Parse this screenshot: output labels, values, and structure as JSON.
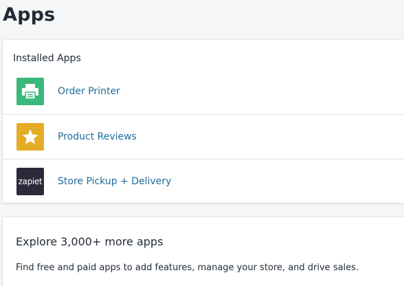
{
  "page": {
    "title": "Apps"
  },
  "installed": {
    "heading": "Installed Apps",
    "apps": [
      {
        "name": "Order Printer",
        "icon": "printer-icon",
        "icon_bg": "#3bb87b"
      },
      {
        "name": "Product Reviews",
        "icon": "star-icon",
        "icon_bg": "#e5ad25"
      },
      {
        "name": "Store Pickup + Delivery",
        "icon": "zapiet-logo-icon",
        "icon_bg": "#2c2a3a",
        "icon_text": "zapiet"
      }
    ]
  },
  "explore": {
    "heading": "Explore 3,000+ more apps",
    "description": "Find free and paid apps to add features, manage your store, and drive sales."
  },
  "colors": {
    "link": "#1f6b9a",
    "background": "#f4f6f8",
    "card": "#ffffff"
  }
}
